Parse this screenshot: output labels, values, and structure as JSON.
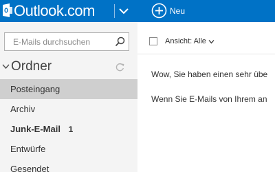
{
  "header": {
    "brand": "Outlook.com",
    "new_label": "Neu",
    "icons": [
      "outlook-logo-icon",
      "chevron-down-icon",
      "plus-circle-icon"
    ]
  },
  "sidebar": {
    "search_placeholder": "E-Mails durchsuchen",
    "folders_title": "Ordner",
    "folders": [
      {
        "label": "Posteingang",
        "selected": true
      },
      {
        "label": "Archiv"
      },
      {
        "label": "Junk-E-Mail",
        "count": "1",
        "bold": true
      },
      {
        "label": "Entwürfe"
      },
      {
        "label": "Gesendet"
      }
    ]
  },
  "main": {
    "view_filter": "Ansicht: Alle",
    "messages": [
      "Wow, Sie haben einen sehr übe",
      "Wenn Sie E-Mails von Ihrem an"
    ]
  },
  "colors": {
    "accent": "#0072c6",
    "sidebar_bg": "#f4f4f4",
    "selected_bg": "#cfcfcf"
  }
}
